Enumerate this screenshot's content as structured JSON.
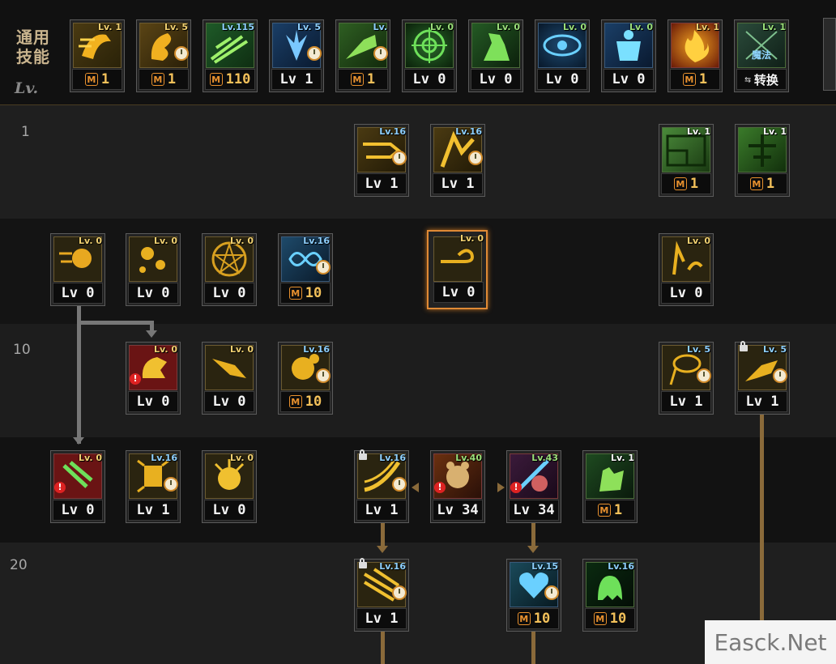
{
  "header": {
    "general_skills_label": "通用\n技能",
    "lv_label": "Lv."
  },
  "row_labels": {
    "r1": "1",
    "r10": "10",
    "r20": "20"
  },
  "general_skills": [
    {
      "lv": "Lv. 1",
      "footer": "1",
      "m": true,
      "clock": false
    },
    {
      "lv": "Lv. 5",
      "footer": "1",
      "m": true,
      "clock": true
    },
    {
      "lv": "Lv.115",
      "footer": "110",
      "m": true,
      "clock": false
    },
    {
      "lv": "Lv. 5",
      "footer": "Lv 1",
      "m": false,
      "clock": true
    },
    {
      "lv": "Lv. ",
      "footer": "1",
      "m": true,
      "clock": true
    },
    {
      "lv": "Lv. 0",
      "footer": "Lv 0",
      "m": false,
      "clock": false
    },
    {
      "lv": "Lv. 0",
      "footer": "Lv 0",
      "m": false,
      "clock": false
    },
    {
      "lv": "Lv. 0",
      "footer": "Lv 0",
      "m": false,
      "clock": false
    },
    {
      "lv": "Lv. 0",
      "footer": "Lv 0",
      "m": false,
      "clock": false
    },
    {
      "lv": "Lv. 1",
      "footer": "1",
      "m": true,
      "clock": false
    },
    {
      "lv": "Lv. 1",
      "footer": "转换",
      "m": false,
      "clock": false,
      "icon_text": "魔法"
    }
  ],
  "skills": {
    "r1a": {
      "lv": "Lv.16",
      "footer": "Lv 1"
    },
    "r1b": {
      "lv": "Lv.16",
      "footer": "Lv 1"
    },
    "r1c": {
      "lv": "Lv. 1",
      "footer": "1"
    },
    "r1d": {
      "lv": "Lv. 1",
      "footer": "1"
    },
    "r2a": {
      "lv": "Lv. 0",
      "footer": "Lv 0"
    },
    "r2b": {
      "lv": "Lv. 0",
      "footer": "Lv 0"
    },
    "r2c": {
      "lv": "Lv. 0",
      "footer": "Lv 0"
    },
    "r2d": {
      "lv": "Lv.16",
      "footer": "10"
    },
    "r2e": {
      "lv": "Lv. 0",
      "footer": "Lv 0"
    },
    "r2f": {
      "lv": "Lv. 0",
      "footer": "Lv 0"
    },
    "r3a": {
      "lv": "Lv. 0",
      "footer": "Lv 0"
    },
    "r3b": {
      "lv": "Lv. 0",
      "footer": "Lv 0"
    },
    "r3c": {
      "lv": "Lv.16",
      "footer": "10"
    },
    "r3d": {
      "lv": "Lv. 5",
      "footer": "Lv 1"
    },
    "r3e": {
      "lv": "Lv. 5",
      "footer": "Lv 1"
    },
    "r4a": {
      "lv": "Lv. 0",
      "footer": "Lv 0"
    },
    "r4b": {
      "lv": "Lv.16",
      "footer": "Lv 1"
    },
    "r4c": {
      "lv": "Lv. 0",
      "footer": "Lv 0"
    },
    "r4d": {
      "lv": "Lv.16",
      "footer": "Lv 1"
    },
    "r4e": {
      "lv": "Lv.40",
      "footer": "Lv 34"
    },
    "r4f": {
      "lv": "Lv.43",
      "footer": "Lv 34"
    },
    "r4g": {
      "lv": "Lv. 1",
      "footer": "1"
    },
    "r5a": {
      "lv": "Lv.16",
      "footer": "Lv 1"
    },
    "r5b": {
      "lv": "Lv.15",
      "footer": "10"
    },
    "r5c": {
      "lv": "Lv.16",
      "footer": "10"
    }
  },
  "watermark": "Easck.Net"
}
